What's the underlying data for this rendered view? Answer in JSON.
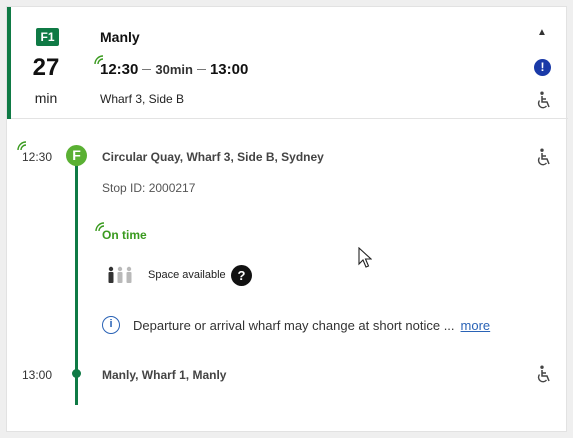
{
  "trip": {
    "route_badge": "F1",
    "minutes": "27",
    "minutes_unit": "min",
    "destination": "Manly",
    "depart_time": "12:30",
    "duration": "30min",
    "arrive_time": "13:00",
    "wharf": "Wharf 3, Side B",
    "expand_icon": "chevron-up-icon",
    "alert_icon": "alert-icon",
    "accessible_icon": "wheelchair-icon",
    "colors": {
      "route": "#0f7a45",
      "ferry": "#5ab033",
      "on_time": "#3a9a1f",
      "alert": "#1a3aa8",
      "link": "#2a63b6"
    }
  },
  "stops": [
    {
      "time": "12:30",
      "mode_icon": "F",
      "name": "Circular Quay, Wharf 3, Side B, Sydney",
      "stop_id": "Stop ID: 2000217"
    },
    {
      "time": "13:00",
      "name": "Manly, Wharf 1, Manly"
    }
  ],
  "status": {
    "on_time": "On time",
    "occupancy_label": "Space available",
    "help_icon": "?",
    "info_icon": "i",
    "info_text": "Departure or arrival wharf may change at short notice ...",
    "more_link": "more"
  }
}
